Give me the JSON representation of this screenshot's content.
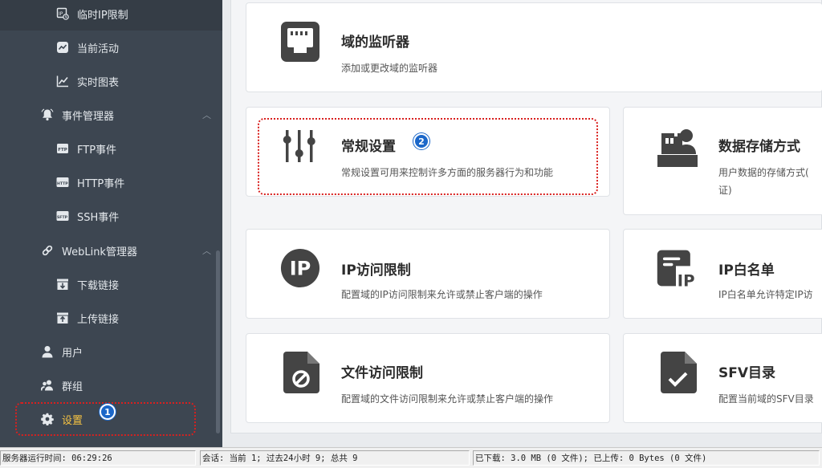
{
  "sidebar": {
    "items": [
      {
        "label": "临时IP限制",
        "icon": "ip-limit-icon"
      },
      {
        "label": "当前活动",
        "icon": "activity-icon"
      },
      {
        "label": "实时图表",
        "icon": "chart-icon"
      },
      {
        "label": "事件管理器",
        "icon": "bell-icon"
      },
      {
        "label": "FTP事件",
        "icon": "ftp-icon"
      },
      {
        "label": "HTTP事件",
        "icon": "http-icon"
      },
      {
        "label": "SSH事件",
        "icon": "sftp-icon"
      },
      {
        "label": "WebLink管理器",
        "icon": "link-icon"
      },
      {
        "label": "下载链接",
        "icon": "download-link-icon"
      },
      {
        "label": "上传链接",
        "icon": "upload-link-icon"
      },
      {
        "label": "用户",
        "icon": "user-icon"
      },
      {
        "label": "群组",
        "icon": "group-icon"
      },
      {
        "label": "设置",
        "icon": "gear-icon"
      }
    ],
    "badge1": "1"
  },
  "cards": {
    "listener": {
      "title": "域的监听器",
      "desc": "添加或更改域的监听器",
      "icon": "network-port-icon"
    },
    "general": {
      "title": "常规设置",
      "desc": "常规设置可用来控制许多方面的服务器行为和功能",
      "icon": "sliders-icon",
      "badge": "2"
    },
    "storage": {
      "title": "数据存储方式",
      "desc1": "用户数据的存储方式(",
      "desc2": "证)",
      "icon": "user-storage-icon"
    },
    "ip_access": {
      "title": "IP访问限制",
      "desc": "配置域的IP访问限制来允许或禁止客户端的操作",
      "icon": "ip-circle-icon",
      "icon_text": "IP"
    },
    "ip_whitelist": {
      "title": "IP白名单",
      "desc": "IP白名单允许特定IP访",
      "icon": "ip-whitelist-icon",
      "icon_text": "IP"
    },
    "file_access": {
      "title": "文件访问限制",
      "desc": "配置域的文件访问限制来允许或禁止客户端的操作",
      "icon": "file-block-icon"
    },
    "sfv": {
      "title": "SFV目录",
      "desc": "配置当前域的SFV目录",
      "icon": "file-check-icon"
    }
  },
  "statusbar": {
    "uptime": "服务器运行时间: 06:29:26",
    "sessions": "会话: 当前 1; 过去24小时 9; 总共 9",
    "transfer": "已下载: 3.0 MB (0 文件); 已上传: 0 Bytes (0 文件)"
  },
  "colors": {
    "sidebar_bg": "#3d4651",
    "settings_accent": "#f5c242",
    "highlight_red": "#d9201f",
    "badge_blue": "#1b67c9",
    "icon_dark": "#444444"
  }
}
